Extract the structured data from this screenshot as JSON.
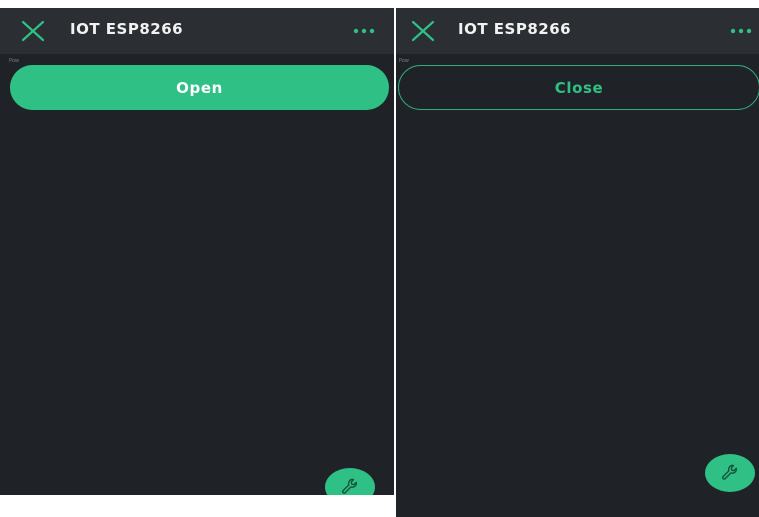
{
  "screens": [
    {
      "app_title": "IOT ESP8266",
      "widget_label": "Pow",
      "button_label": "Open"
    },
    {
      "app_title": "IOT ESP8266",
      "widget_label": "Pow",
      "button_label": "Close"
    }
  ],
  "icons": {
    "close": "close-icon",
    "more": "more-icon",
    "fab": "wrench-icon"
  },
  "colors": {
    "background": "#1f2227",
    "appbar": "#2b2e33",
    "accent": "#2fc085",
    "title": "#f2f2f2"
  }
}
